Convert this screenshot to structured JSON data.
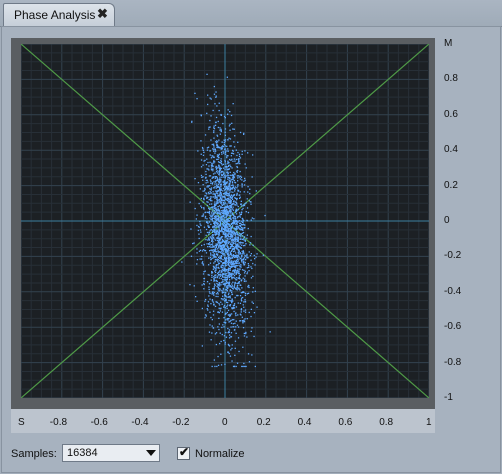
{
  "tab": {
    "title": "Phase Analysis",
    "close_glyph": "✖"
  },
  "plot": {
    "background": "#1c2024",
    "grid_major_color": "#33424f",
    "grid_minor_color": "#272f37",
    "axis_color": "#3d7fa0",
    "diagonal_color": "#4f9a47",
    "point_color": "#5fa9ff",
    "x_ticks": [
      "S",
      "-0.8",
      "-0.6",
      "-0.4",
      "-0.2",
      "0",
      "0.2",
      "0.4",
      "0.6",
      "0.8",
      "1"
    ],
    "y_ticks": [
      "M",
      "0.8",
      "0.6",
      "0.4",
      "0.2",
      "0",
      "-0.2",
      "-0.4",
      "-0.6",
      "-0.8",
      "-1"
    ]
  },
  "controls": {
    "samples_label": "Samples:",
    "samples_value": "16384",
    "normalize_label": "Normalize",
    "normalize_checked": "✔"
  },
  "icons": {
    "close": "close-icon",
    "dropdown": "chevron-down-icon",
    "checkbox": "check-icon"
  }
}
